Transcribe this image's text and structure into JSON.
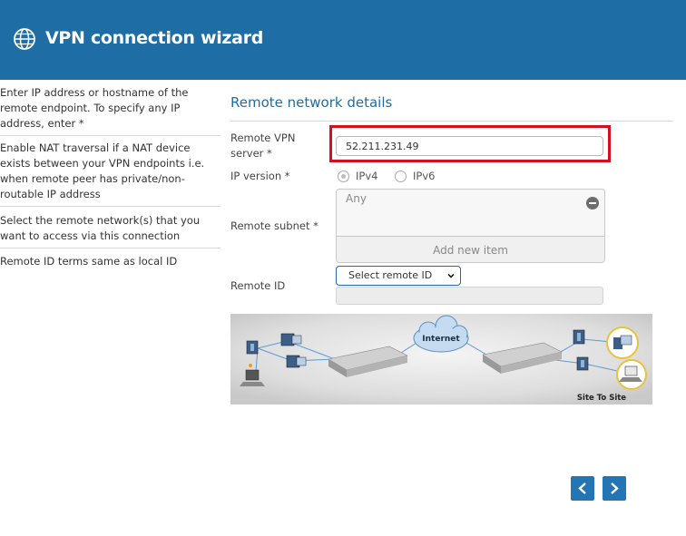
{
  "header": {
    "title": "VPN connection wizard",
    "icon": "globe-icon"
  },
  "help": [
    "Enter IP address or hostname of the remote endpoint. To specify any IP address, enter *",
    "Enable NAT traversal if a NAT device exists between your VPN endpoints i.e. when remote peer has private/non-routable IP address",
    "Select the remote network(s) that you want to access via this connection",
    "Remote ID terms same as local ID"
  ],
  "section": {
    "title": "Remote network details"
  },
  "form": {
    "remote_vpn_label": "Remote VPN server *",
    "remote_vpn_value": "52.211.231.49",
    "ip_version_label": "IP version *",
    "ipv4_label": "IPv4",
    "ipv6_label": "IPv6",
    "ip_version_selected": "IPv4",
    "remote_subnet_label": "Remote subnet *",
    "subnet_item": "Any",
    "add_item_label": "Add new item",
    "remote_id_label": "Remote ID",
    "remote_id_select": "Select remote ID",
    "remote_id_value": ""
  },
  "diagram": {
    "cloud_label": "Internet",
    "caption": "Site To Site"
  },
  "nav": {
    "prev_icon": "chevron-left-icon",
    "next_icon": "chevron-right-icon"
  },
  "colors": {
    "brand": "#1e6da4",
    "highlight": "#d0121e",
    "nav_button": "#2276b5"
  }
}
